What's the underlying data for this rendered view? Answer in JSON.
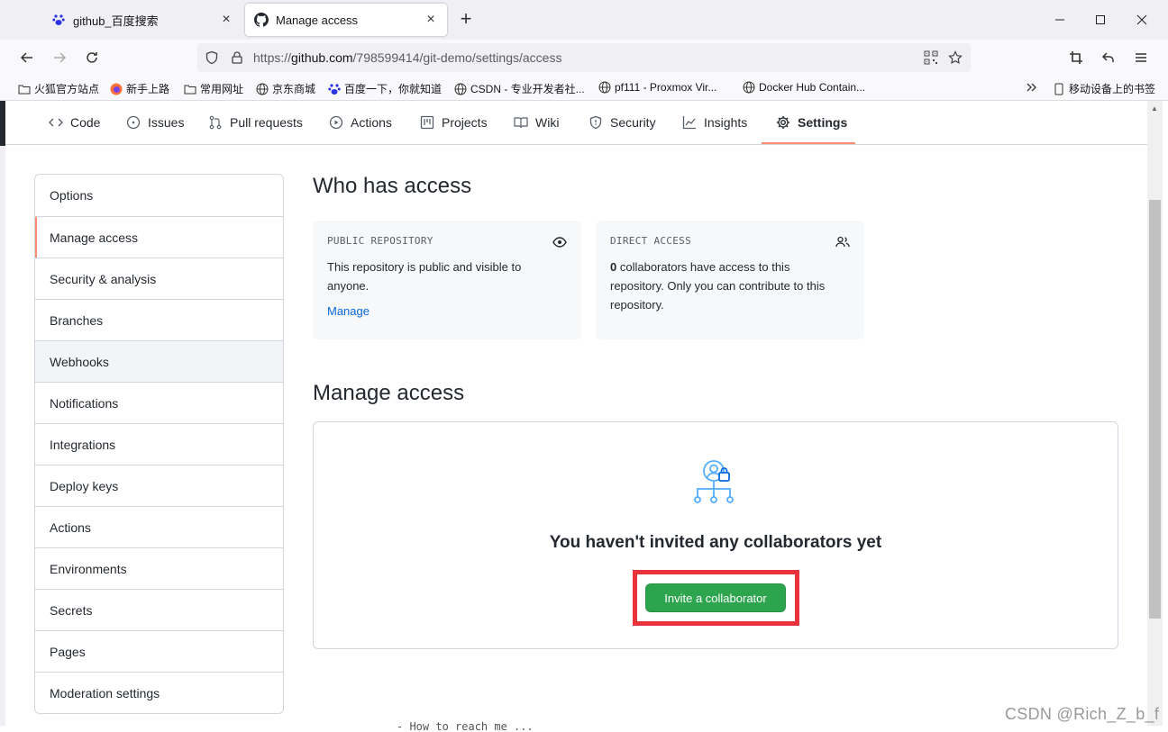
{
  "browser": {
    "tabs": [
      {
        "title": "github_百度搜索",
        "icon": "baidu-paw-icon",
        "active": false
      },
      {
        "title": "Manage access",
        "icon": "github-icon",
        "active": true
      }
    ],
    "url": {
      "scheme": "https://",
      "host": "github.com",
      "path": "/798599414/git-demo/settings/access"
    },
    "bookmarks": [
      {
        "label": "火狐官方站点",
        "icon": "folder-icon"
      },
      {
        "label": "新手上路",
        "icon": "firefox-icon"
      },
      {
        "label": "常用网址",
        "icon": "folder-icon"
      },
      {
        "label": "京东商城",
        "icon": "globe-icon"
      },
      {
        "label": "百度一下，你就知道",
        "icon": "baidu-paw-icon"
      },
      {
        "label": "CSDN - 专业开发者社...",
        "icon": "globe-icon"
      },
      {
        "label": "pf111 - Proxmox Vir...",
        "icon": "globe-icon"
      },
      {
        "label": "Docker Hub Contain...",
        "icon": "globe-icon"
      }
    ],
    "mobile_bookmarks": "移动设备上的书签"
  },
  "repo_nav": {
    "items": [
      {
        "label": "Code",
        "icon": "code-icon"
      },
      {
        "label": "Issues",
        "icon": "issue-icon"
      },
      {
        "label": "Pull requests",
        "icon": "pull-request-icon"
      },
      {
        "label": "Actions",
        "icon": "play-icon"
      },
      {
        "label": "Projects",
        "icon": "project-icon"
      },
      {
        "label": "Wiki",
        "icon": "book-icon"
      },
      {
        "label": "Security",
        "icon": "shield-icon"
      },
      {
        "label": "Insights",
        "icon": "graph-icon"
      },
      {
        "label": "Settings",
        "icon": "gear-icon"
      }
    ],
    "selected": "Settings"
  },
  "sidebar": {
    "items": [
      {
        "label": "Options"
      },
      {
        "label": "Manage access"
      },
      {
        "label": "Security & analysis"
      },
      {
        "label": "Branches"
      },
      {
        "label": "Webhooks"
      },
      {
        "label": "Notifications"
      },
      {
        "label": "Integrations"
      },
      {
        "label": "Deploy keys"
      },
      {
        "label": "Actions"
      },
      {
        "label": "Environments"
      },
      {
        "label": "Secrets"
      },
      {
        "label": "Pages"
      },
      {
        "label": "Moderation settings"
      }
    ],
    "selected": "Manage access"
  },
  "who_has_access": {
    "title": "Who has access",
    "public_card": {
      "label": "PUBLIC REPOSITORY",
      "description": "This repository is public and visible to anyone.",
      "link": "Manage",
      "icon": "eye-icon"
    },
    "direct_card": {
      "label": "DIRECT ACCESS",
      "count": "0",
      "description": " collaborators have access to this repository. Only you can contribute to this repository.",
      "icon": "people-icon"
    }
  },
  "manage_access": {
    "title": "Manage access",
    "empty_title": "You haven't invited any collaborators yet",
    "invite_button": "Invite a collaborator",
    "icon": "collaborators-lock-icon"
  },
  "watermark": "CSDN @Rich_Z_b_f",
  "background_text": "- How to reach me ..."
}
